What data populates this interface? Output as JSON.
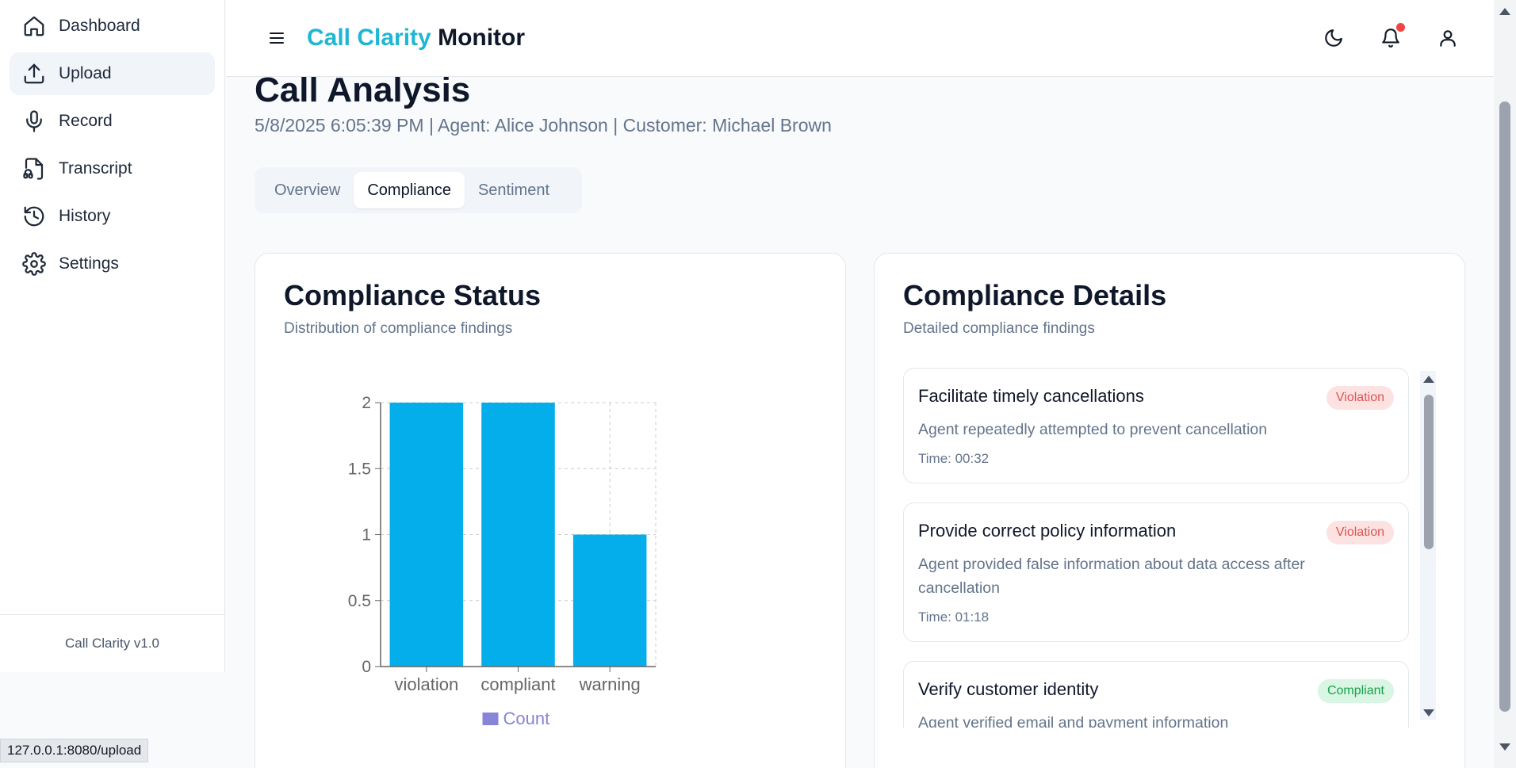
{
  "sidebar": {
    "items": [
      {
        "label": "Dashboard",
        "icon": "home-icon"
      },
      {
        "label": "Upload",
        "icon": "upload-icon"
      },
      {
        "label": "Record",
        "icon": "mic-icon"
      },
      {
        "label": "Transcript",
        "icon": "file-audio-icon"
      },
      {
        "label": "History",
        "icon": "history-icon"
      },
      {
        "label": "Settings",
        "icon": "gear-icon"
      }
    ],
    "active": "Upload",
    "footer": "Call Clarity v1.0"
  },
  "header": {
    "brand_accent": "Call Clarity",
    "brand_rest": "Monitor",
    "accent_color": "#1fb6d3",
    "icons": [
      "menu-icon",
      "moon-icon",
      "bell-icon",
      "user-icon"
    ]
  },
  "page": {
    "title": "Call Analysis",
    "meta": "5/8/2025 6:05:39 PM | Agent: Alice Johnson | Customer: Michael Brown"
  },
  "tabs": [
    {
      "label": "Overview"
    },
    {
      "label": "Compliance"
    },
    {
      "label": "Sentiment"
    }
  ],
  "active_tab": "Compliance",
  "status_card": {
    "title": "Compliance Status",
    "subtitle": "Distribution of compliance findings"
  },
  "chart_data": {
    "type": "bar",
    "categories": [
      "violation",
      "compliant",
      "warning"
    ],
    "series": [
      {
        "name": "Count",
        "values": [
          2,
          2,
          1
        ]
      }
    ],
    "ylim": [
      0,
      2
    ],
    "yticks": [
      "0",
      "0.5",
      "1",
      "1.5",
      "2"
    ],
    "grid": true,
    "legend": "bottom",
    "bar_color": "#03aeea",
    "legend_color": "#8884d8"
  },
  "details_card": {
    "title": "Compliance Details",
    "subtitle": "Detailed compliance findings",
    "findings": [
      {
        "title": "Facilitate timely cancellations",
        "status": "Violation",
        "description": "Agent repeatedly attempted to prevent cancellation",
        "time": "Time: 00:32"
      },
      {
        "title": "Provide correct policy information",
        "status": "Violation",
        "description": "Agent provided false information about data access after cancellation",
        "time": "Time: 01:18"
      },
      {
        "title": "Verify customer identity",
        "status": "Compliant",
        "description": "Agent verified email and payment information",
        "time": ""
      }
    ]
  },
  "status_bar": {
    "url": "127.0.0.1:8080/upload"
  }
}
